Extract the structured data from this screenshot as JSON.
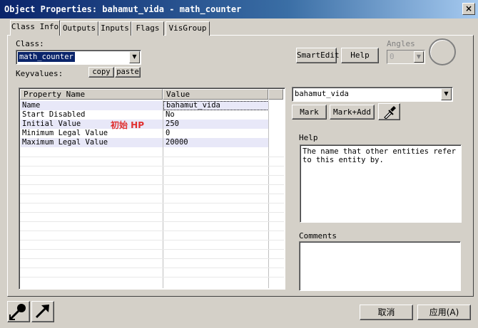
{
  "window": {
    "title": "Object Properties: bahamut_vida - math_counter",
    "close_label": "×"
  },
  "tabs": [
    {
      "label": "Class Info"
    },
    {
      "label": "Outputs"
    },
    {
      "label": "Inputs"
    },
    {
      "label": "Flags"
    },
    {
      "label": "VisGroup"
    }
  ],
  "class": {
    "label": "Class:",
    "value": "math_counter"
  },
  "keyvalues": {
    "label": "Keyvalues:",
    "copy_label": "copy",
    "paste_label": "paste"
  },
  "buttons": {
    "smartedit": "SmartEdit",
    "help": "Help",
    "mark": "Mark",
    "markadd": "Mark+Add"
  },
  "angles": {
    "label": "Angles",
    "value": "0"
  },
  "grid": {
    "col_property": "Property Name",
    "col_value": "Value",
    "rows": [
      {
        "name": "Name",
        "value": "bahamut_vida"
      },
      {
        "name": "Start Disabled",
        "value": "No"
      },
      {
        "name": "Initial Value",
        "value": "250"
      },
      {
        "name": "Minimum Legal Value",
        "value": "0"
      },
      {
        "name": "Maximum Legal Value",
        "value": "20000"
      }
    ]
  },
  "annotation": {
    "text": "初始 HP",
    "color": "#e03030"
  },
  "value_editor": {
    "value": "bahamut_vida"
  },
  "help": {
    "label": "Help",
    "text": "The name that other entities refer to this entity by."
  },
  "comments": {
    "label": "Comments",
    "text": ""
  },
  "footer": {
    "cancel_label": "取消",
    "apply_label": "应用(A)"
  },
  "colors": {
    "titlebar": "#0a246a",
    "selection": "#0a246a",
    "dialog": "#d4d0c8"
  }
}
